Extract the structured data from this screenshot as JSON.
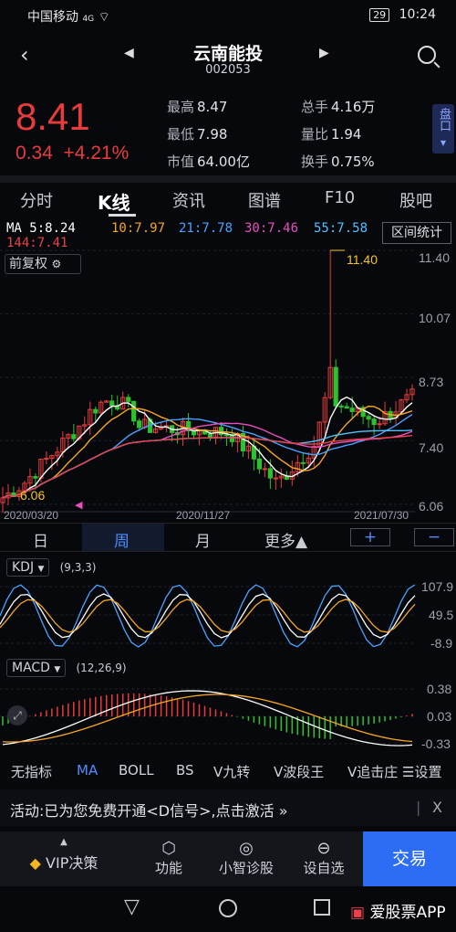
{
  "status": {
    "carrier": "中国移动",
    "network": "4G",
    "time": "10:24",
    "battery": "29"
  },
  "header": {
    "title": "云南能投",
    "code": "002053"
  },
  "quote": {
    "price": "8.41",
    "change": "0.34",
    "change_pct": "+4.21%",
    "stats": [
      {
        "label": "最高",
        "value": "8.47"
      },
      {
        "label": "总手",
        "value": "4.16万"
      },
      {
        "label": "最低",
        "value": "7.98"
      },
      {
        "label": "量比",
        "value": "1.94"
      },
      {
        "label": "市值",
        "value": "64.00亿"
      },
      {
        "label": "换手",
        "value": "0.75%"
      }
    ],
    "pankou": "盘口"
  },
  "tabs": [
    "分时",
    "K线",
    "资讯",
    "图谱",
    "F10",
    "股吧"
  ],
  "ma_legend": {
    "ma5": "MA 5:8.24",
    "ma10": "10:7.97",
    "ma21": "21:7.78",
    "ma30": "30:7.46",
    "ma55": "55:7.58",
    "ma144": "144:7.41",
    "range_button": "区间统计"
  },
  "colors": {
    "ma5": "#ffffff",
    "ma10": "#f5a623",
    "ma21": "#4aa3ff",
    "ma30": "#e84fbd",
    "ma55": "#4fc3ff",
    "ma144": "#e8434a",
    "up": "#e83c3c",
    "down": "#2dc22d"
  },
  "kline": {
    "adjust": "前复权",
    "y_ticks": [
      "11.40",
      "10.07",
      "8.73",
      "7.40",
      "6.06"
    ],
    "high_label": "11.40",
    "low_label": "6.06",
    "x_ticks": [
      "2020/03/20",
      "2020/11/27",
      "2021/07/30"
    ]
  },
  "periods": [
    "日",
    "周",
    "月",
    "更多▲"
  ],
  "period_plus": "+",
  "period_minus": "−",
  "kdj": {
    "name": "KDJ",
    "params": "(9,3,3)",
    "ticks": [
      "107.9",
      "49.5",
      "-8.9"
    ]
  },
  "macd": {
    "name": "MACD",
    "params": "(12,26,9)",
    "ticks": [
      "0.38",
      "0.03",
      "-0.33"
    ]
  },
  "indicators": [
    "无指标",
    "MA",
    "BOLL",
    "BS",
    "V九转",
    "V波段王",
    "V追击庄"
  ],
  "settings_label": "设置",
  "promo": {
    "text": "活动:已为您免费开通<D信号>,点击激活 »",
    "close": "X"
  },
  "bottom_bar": [
    {
      "label": "VIP决策",
      "icon": "vip-diamond-icon"
    },
    {
      "label": "功能",
      "icon": "cube-icon"
    },
    {
      "label": "小智诊股",
      "icon": "pulse-icon"
    },
    {
      "label": "设自选",
      "icon": "minus-circle-icon"
    }
  ],
  "trade_button": "交易",
  "watermark": "爱股票APP"
}
